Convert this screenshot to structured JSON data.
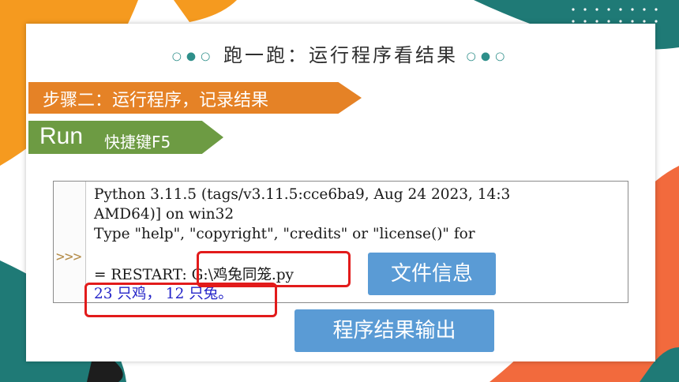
{
  "page": {
    "title": "跑一跑：运行程序看结果",
    "title_dots_left": "○●○",
    "title_dots_right": "○●○"
  },
  "step_banner": {
    "text": "步骤二：运行程序，记录结果",
    "color": "#e58226"
  },
  "run_banner": {
    "run_label": "Run",
    "shortcut_label": "快捷键F5",
    "color": "#6d9b43"
  },
  "shell": {
    "prompt": ">>>",
    "lines": [
      "Python 3.11.5 (tags/v3.11.5:cce6ba9, Aug 24 2023, 14:3",
      "AMD64)] on win32",
      "Type \"help\", \"copyright\", \"credits\" or \"license()\" for",
      "= RESTART: G:\\鸡兔同笼.py",
      "23 只鸡， 12 只兔。"
    ]
  },
  "annotations": {
    "file_info": "文件信息",
    "output": "程序结果输出",
    "box_color": "#5a9bd5",
    "highlight_color": "#e21b1b"
  },
  "decor": {
    "orange": "#f59a1f",
    "teal": "#1f7a76",
    "coral": "#f26a3d",
    "dark": "#1d1d1d"
  }
}
